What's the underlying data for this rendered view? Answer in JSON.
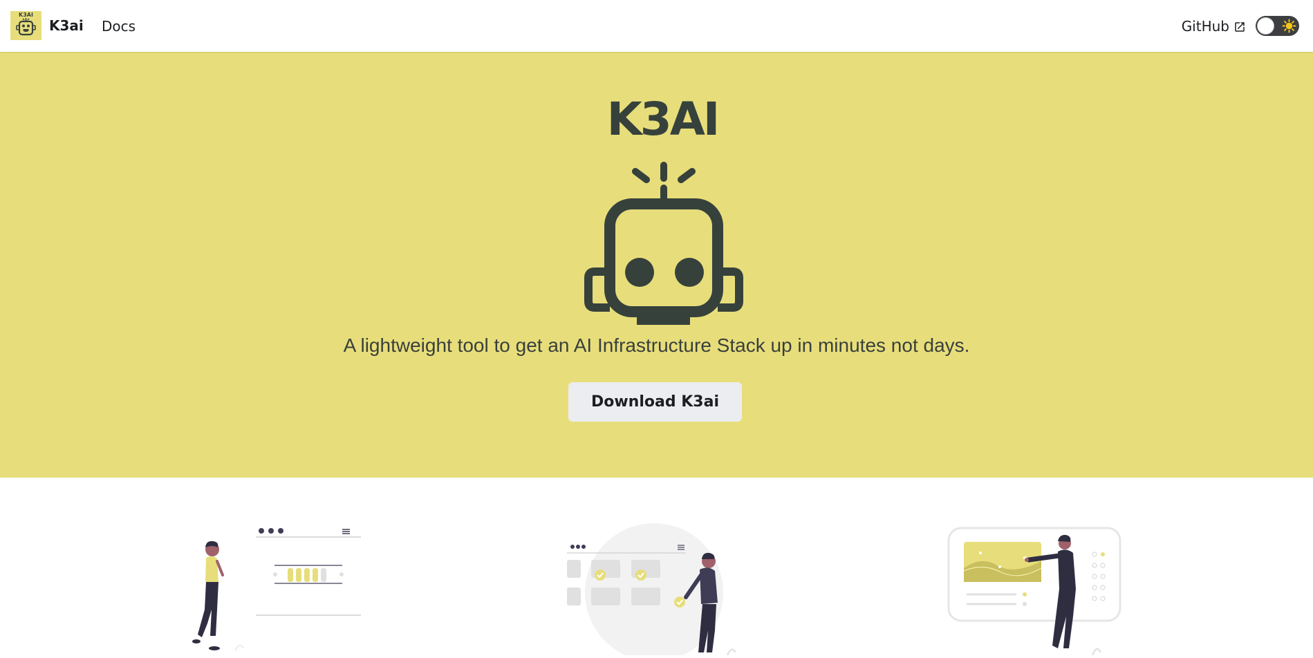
{
  "navbar": {
    "brand_title": "K3ai",
    "brand_logo_text": "K3AI",
    "docs_label": "Docs",
    "github_label": "GitHub",
    "theme_toggle": "dark-mode-toggle"
  },
  "hero": {
    "wordmark": "K3AI",
    "tagline": "A lightweight tool to get an AI Infrastructure Stack up in minutes not days.",
    "download_label": "Download K3ai"
  },
  "colors": {
    "hero_bg": "#e7de7b",
    "logo_dark": "#37413c",
    "button_bg": "#ebedf0"
  },
  "icons": [
    "external-link-icon",
    "sun-icon",
    "robot-logo-icon"
  ],
  "features": [
    {
      "illustration": "woman-with-dashboard-illustration"
    },
    {
      "illustration": "man-checking-tasks-illustration"
    },
    {
      "illustration": "man-presenting-chart-illustration"
    }
  ]
}
